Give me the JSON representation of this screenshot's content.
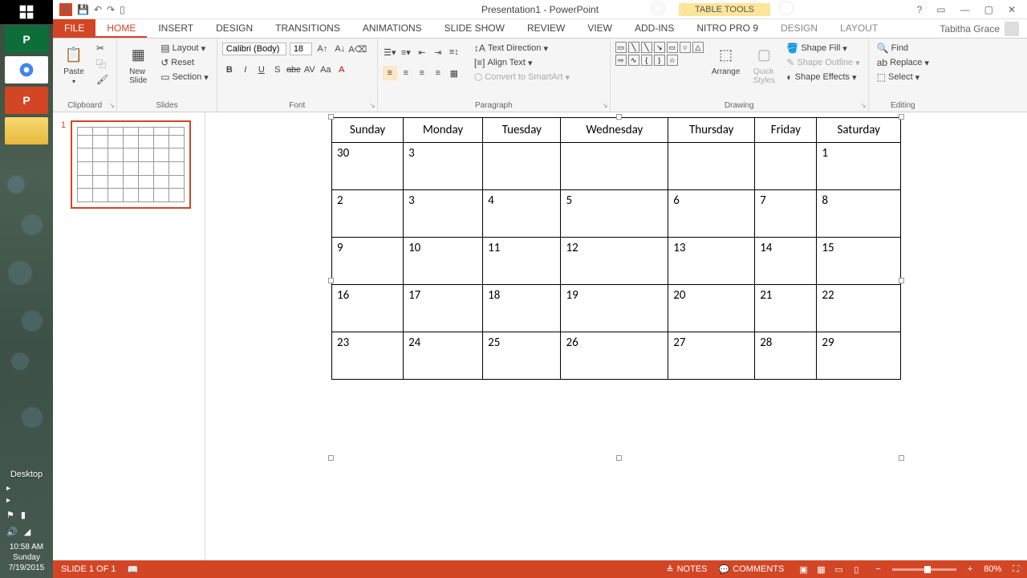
{
  "taskbar": {
    "desktop_label": "Desktop",
    "time": "10:58 AM",
    "day": "Sunday",
    "date": "7/19/2015"
  },
  "titlebar": {
    "title": "Presentation1 - PowerPoint",
    "tool_tab": "TABLE TOOLS"
  },
  "tabs": {
    "file": "FILE",
    "home": "HOME",
    "insert": "INSERT",
    "design": "DESIGN",
    "transitions": "TRANSITIONS",
    "animations": "ANIMATIONS",
    "slideshow": "SLIDE SHOW",
    "review": "REVIEW",
    "view": "VIEW",
    "addins": "ADD-INS",
    "nitro": "NITRO PRO 9",
    "tdesign": "DESIGN",
    "tlayout": "LAYOUT"
  },
  "user": "Tabitha Grace",
  "ribbon": {
    "clipboard": {
      "label": "Clipboard",
      "paste": "Paste"
    },
    "slides": {
      "label": "Slides",
      "new_slide": "New\nSlide",
      "layout": "Layout",
      "reset": "Reset",
      "section": "Section"
    },
    "font": {
      "label": "Font",
      "name": "Calibri (Body)",
      "size": "18"
    },
    "paragraph": {
      "label": "Paragraph",
      "text_direction": "Text Direction",
      "align_text": "Align Text",
      "smartart": "Convert to SmartArt"
    },
    "drawing": {
      "label": "Drawing",
      "arrange": "Arrange",
      "quick_styles": "Quick\nStyles",
      "shape_fill": "Shape Fill",
      "shape_outline": "Shape Outline",
      "shape_effects": "Shape Effects"
    },
    "editing": {
      "label": "Editing",
      "find": "Find",
      "replace": "Replace",
      "select": "Select"
    }
  },
  "thumb": {
    "number": "1"
  },
  "calendar": {
    "headers": [
      "Sunday",
      "Monday",
      "Tuesday",
      "Wednesday",
      "Thursday",
      "Friday",
      "Saturday"
    ],
    "rows": [
      [
        "30",
        "3",
        "",
        "",
        "",
        "",
        "1"
      ],
      [
        "2",
        "3",
        "4",
        "5",
        "6",
        "7",
        "8"
      ],
      [
        "9",
        "10",
        "11",
        "12",
        "13",
        "14",
        "15"
      ],
      [
        "16",
        "17",
        "18",
        "19",
        "20",
        "21",
        "22"
      ],
      [
        "23",
        "24",
        "25",
        "26",
        "27",
        "28",
        "29"
      ]
    ]
  },
  "status": {
    "slide": "SLIDE 1 OF 1",
    "notes": "NOTES",
    "comments": "COMMENTS",
    "zoom": "80%"
  }
}
